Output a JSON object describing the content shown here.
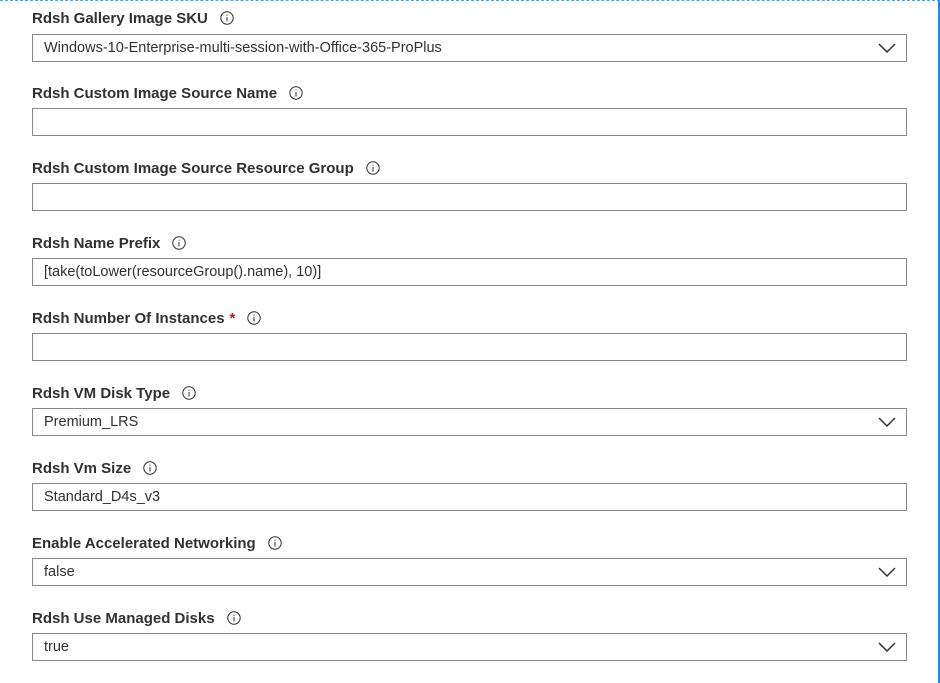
{
  "fields": [
    {
      "label": "Rdsh Gallery Image SKU",
      "type": "select",
      "value": "Windows-10-Enterprise-multi-session-with-Office-365-ProPlus"
    },
    {
      "label": "Rdsh Custom Image Source Name",
      "type": "text",
      "value": ""
    },
    {
      "label": "Rdsh Custom Image Source Resource Group",
      "type": "text",
      "value": ""
    },
    {
      "label": "Rdsh Name Prefix",
      "type": "text",
      "value": "[take(toLower(resourceGroup().name), 10)]"
    },
    {
      "label": "Rdsh Number Of Instances",
      "required_mark": "*",
      "type": "text",
      "value": ""
    },
    {
      "label": "Rdsh VM Disk Type",
      "type": "select",
      "value": "Premium_LRS"
    },
    {
      "label": "Rdsh Vm Size",
      "type": "text",
      "value": "Standard_D4s_v3"
    },
    {
      "label": "Enable Accelerated Networking",
      "type": "select",
      "value": "false"
    },
    {
      "label": "Rdsh Use Managed Disks",
      "type": "select",
      "value": "true"
    }
  ],
  "icons": {
    "info": "info-icon",
    "dropdown": "chevron-down-icon"
  },
  "colors": {
    "required": "#a4262c",
    "border": "#8a8886",
    "label": "#323130",
    "frame": "#2b88d8"
  }
}
